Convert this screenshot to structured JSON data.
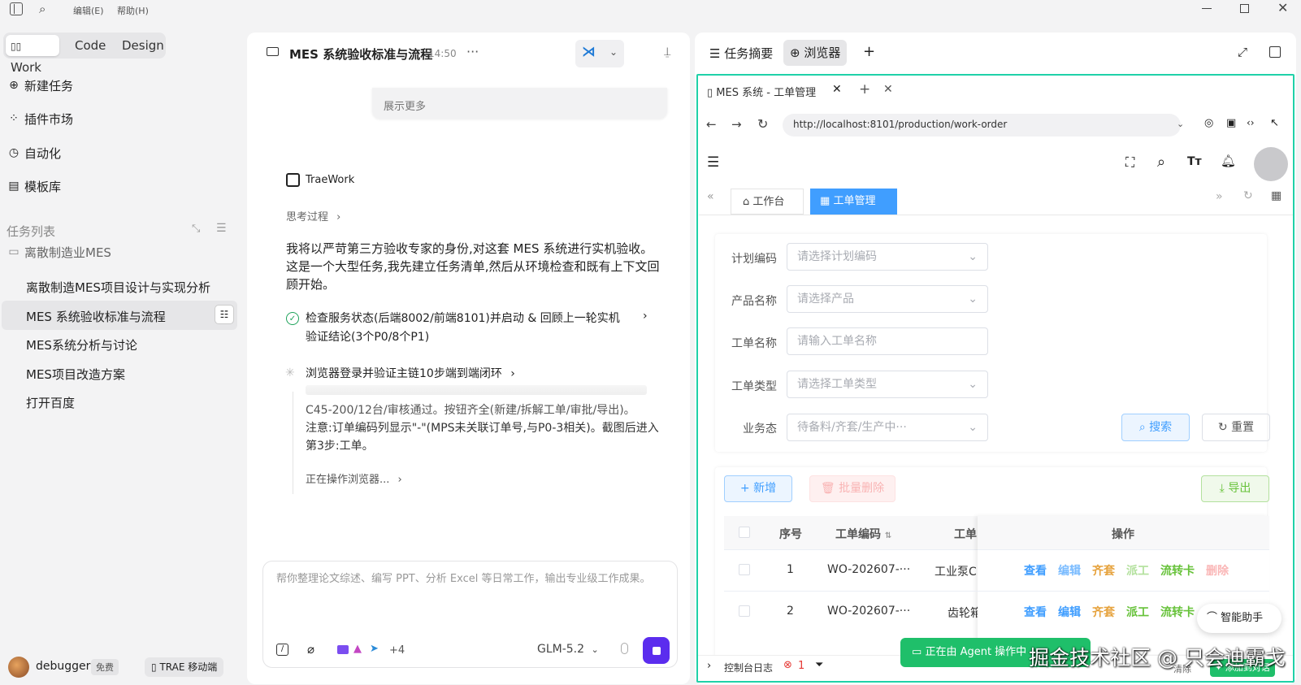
{
  "titlebar": {
    "menu_edit": "编辑(E)",
    "menu_help": "帮助(H)"
  },
  "sidebar": {
    "modes": [
      "Work",
      "Code",
      "Design"
    ],
    "nav": [
      {
        "label": "新建任务",
        "icon": "plus-circle-icon"
      },
      {
        "label": "插件市场",
        "icon": "plugin-icon"
      },
      {
        "label": "自动化",
        "icon": "clock-icon"
      },
      {
        "label": "模板库",
        "icon": "template-icon"
      }
    ],
    "task_list_title": "任务列表",
    "folder": "离散制造业MES",
    "tasks": [
      "离散制造MES项目设计与实现分析",
      "MES 系统验收标准与流程",
      "MES系统分析与讨论",
      "MES项目改造方案",
      "打开百度"
    ],
    "user": {
      "name": "debugger",
      "plan": "免费",
      "mobile": "TRAE 移动端"
    }
  },
  "chat": {
    "title": "MES 系统验收标准与流程",
    "time": "14:50",
    "show_more": "展示更多",
    "agent_name": "TraeWork",
    "thinking": "思考过程",
    "message": "我将以严苛第三方验收专家的身份,对这套 MES 系统进行实机验收。这是一个大型任务,我先建立任务清单,然后从环境检查和既有上下文回顾开始。",
    "step1": "检查服务状态(后端8002/前端8101)并启动 & 回顾上一轮实机验证结论(3个P0/8个P1)",
    "step2": "浏览器登录并验证主链10步端到端闭环",
    "detail_partial": "C45-200/12台/审核通过。按钮齐全(新建/拆解工单/审批/导出)。",
    "detail_note": "注意:订单编码列显示\"-\"(MPS未关联订单号,与P0-3相关)。截图后进入第3步:工单。",
    "operating": "正在操作浏览器...",
    "input_placeholder": "帮你整理论文综述、编写 PPT、分析 Excel 等日常工作，输出专业级工作成果。",
    "plus_count": "+4",
    "model": "GLM-5.2"
  },
  "right": {
    "tab_summary": "任务摘要",
    "tab_browser": "浏览器",
    "browser_tab_title": "MES 系统 - 工单管理",
    "url": "http://localhost:8101/production/work-order",
    "app_tabs": [
      "工作台",
      "工单管理"
    ],
    "form": {
      "fields": [
        {
          "label": "计划编码",
          "placeholder": "请选择计划编码",
          "select": true
        },
        {
          "label": "产品名称",
          "placeholder": "请选择产品",
          "select": true
        },
        {
          "label": "工单名称",
          "placeholder": "请输入工单名称",
          "select": false
        },
        {
          "label": "工单类型",
          "placeholder": "请选择工单类型",
          "select": true
        },
        {
          "label": "业务态",
          "placeholder": "待备料/齐套/生产中···",
          "select": true
        }
      ],
      "search": "搜索",
      "reset": "重置"
    },
    "toolbar": {
      "add": "新增",
      "batch_delete": "批量删除",
      "export": "导出"
    },
    "table": {
      "headers": [
        "序号",
        "工单编码",
        "工单",
        "操作"
      ],
      "rows": [
        {
          "no": "1",
          "code": "WO-202607-···",
          "name": "工业泵C"
        },
        {
          "no": "2",
          "code": "WO-202607-···",
          "name": "齿轮箱"
        }
      ],
      "ops": [
        "查看",
        "编辑",
        "齐套",
        "派工",
        "流转卡",
        "删除"
      ]
    },
    "assistant": "智能助手",
    "console": "控制台日志",
    "error_count": "1",
    "agent_status": "正在由 Agent 操作中",
    "clear": "清除",
    "add_to_chat": "添加到对话"
  },
  "watermark": "掘金技术社区 @ 只会迪霸戈",
  "colors": {
    "accent": "#409eff",
    "green": "#1fbf6a",
    "stop": "#5b2dee"
  }
}
